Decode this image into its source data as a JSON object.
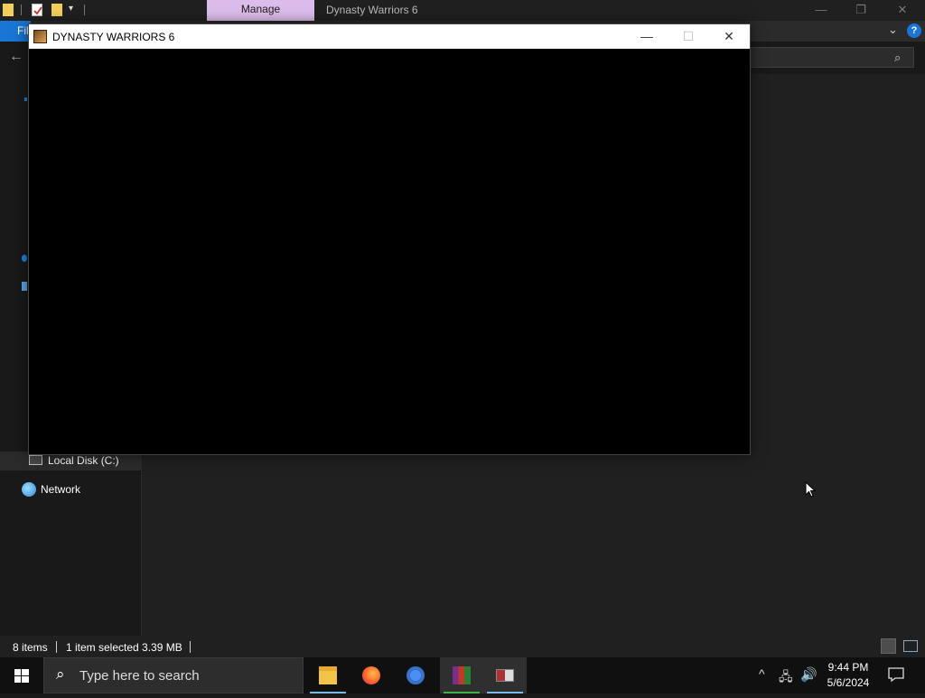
{
  "explorer": {
    "title": "Dynasty Warriors 6",
    "manage_tab": "Manage",
    "file_tab": "File",
    "window_controls": {
      "minimize": "—",
      "restore": "❐",
      "close": "✕"
    },
    "ribbon_chevron": "⌄",
    "help": "?",
    "back": "←",
    "search_icon": "⌕"
  },
  "nav": {
    "local_disk": "Local Disk (C:)",
    "network": "Network"
  },
  "status": {
    "items": "8 items",
    "selected": "1 item selected  3.39 MB"
  },
  "game_window": {
    "title": "DYNASTY WARRIORS 6",
    "controls": {
      "minimize": "—",
      "maximize": "☐",
      "close": "✕"
    }
  },
  "taskbar": {
    "search_placeholder": "Type here to search",
    "search_icon": "⌕",
    "tray": {
      "chevron": "^",
      "network": "🖧",
      "volume": "🔊"
    },
    "clock": {
      "time": "9:44 PM",
      "date": "5/6/2024"
    },
    "apps": [
      "file-explorer",
      "firefox",
      "chrome",
      "winrar",
      "dynasty-warriors-6"
    ]
  },
  "colors": {
    "manage_tab": "#dcbcea",
    "file_tab": "#1976d2",
    "accent_underline": "#76b9ed"
  }
}
